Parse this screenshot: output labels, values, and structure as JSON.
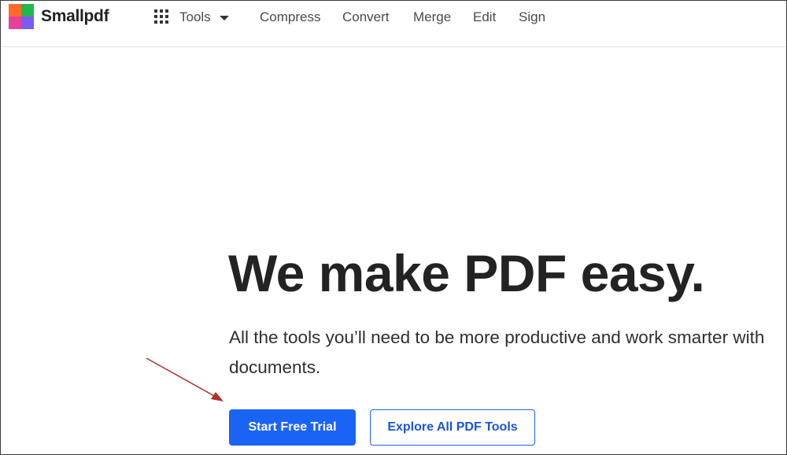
{
  "header": {
    "brand": "Smallpdf",
    "logo_colors": [
      "#ff6a2a",
      "#20b84e",
      "#e4409c",
      "#7a5cf0"
    ],
    "tools_label": "Tools",
    "nav": [
      "Compress",
      "Convert",
      "Merge",
      "Edit",
      "Sign"
    ]
  },
  "hero": {
    "title": "We make PDF easy.",
    "subtitle": "All the tools you’ll need to be more productive and work smarter with documents.",
    "primary_cta": "Start Free Trial",
    "secondary_cta": "Explore All PDF Tools"
  },
  "colors": {
    "accent": "#1a64f5",
    "annotation_arrow": "#b0302a"
  }
}
